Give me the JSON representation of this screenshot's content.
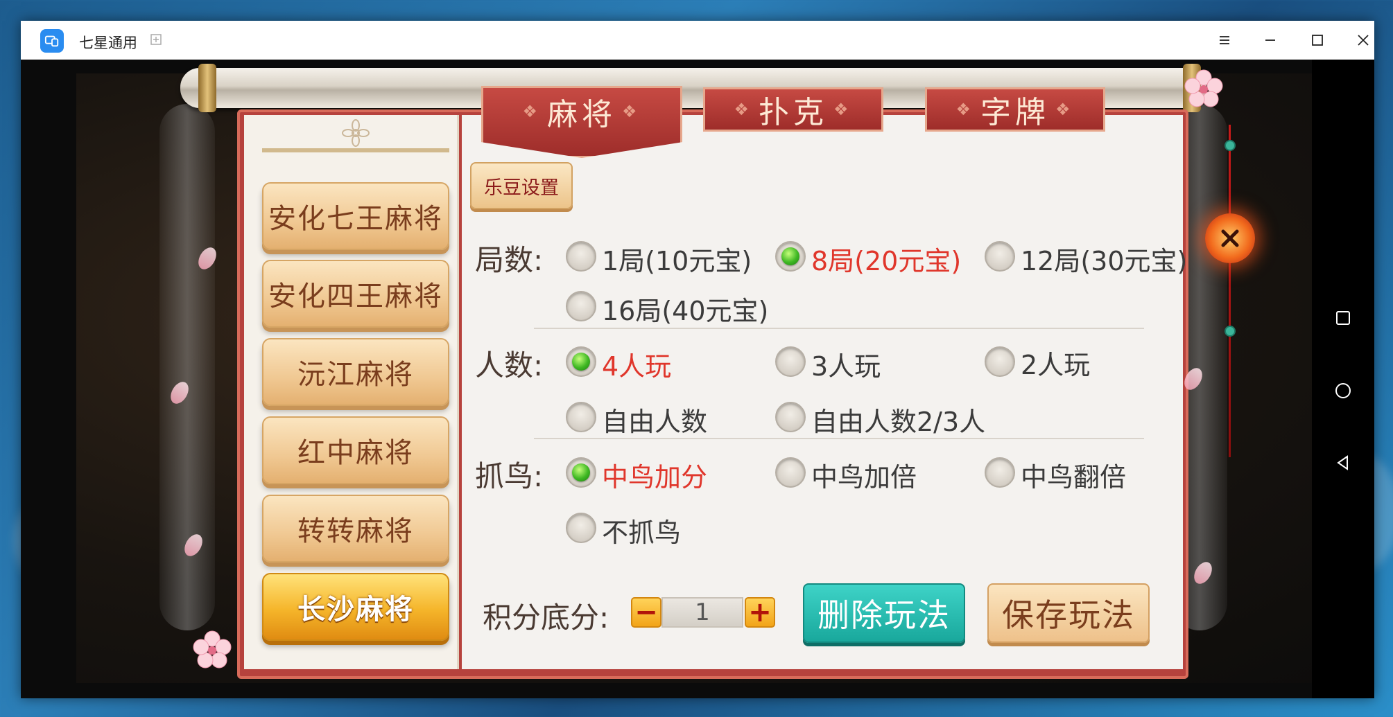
{
  "window": {
    "title": "七星通用"
  },
  "dialog": {
    "tabs": [
      {
        "label": "麻将",
        "active": true
      },
      {
        "label": "扑克",
        "active": false
      },
      {
        "label": "字牌",
        "active": false
      }
    ],
    "ledou_settings_label": "乐豆设置",
    "game_list": [
      {
        "label": "安化七王麻将",
        "active": false
      },
      {
        "label": "安化四王麻将",
        "active": false
      },
      {
        "label": "沅江麻将",
        "active": false
      },
      {
        "label": "红中麻将",
        "active": false
      },
      {
        "label": "转转麻将",
        "active": false
      },
      {
        "label": "长沙麻将",
        "active": true
      }
    ],
    "rounds": {
      "label": "局数:",
      "options": [
        {
          "label": "1局(10元宝)",
          "selected": false
        },
        {
          "label": "8局(20元宝)",
          "selected": true
        },
        {
          "label": "12局(30元宝)",
          "selected": false
        },
        {
          "label": "16局(40元宝)",
          "selected": false
        }
      ]
    },
    "players": {
      "label": "人数:",
      "options": [
        {
          "label": "4人玩",
          "selected": true
        },
        {
          "label": "3人玩",
          "selected": false
        },
        {
          "label": "2人玩",
          "selected": false
        },
        {
          "label": "自由人数",
          "selected": false
        },
        {
          "label": "自由人数2/3人",
          "selected": false
        }
      ]
    },
    "birds": {
      "label": "抓鸟:",
      "options": [
        {
          "label": "中鸟加分",
          "selected": true
        },
        {
          "label": "中鸟加倍",
          "selected": false
        },
        {
          "label": "中鸟翻倍",
          "selected": false
        },
        {
          "label": "不抓鸟",
          "selected": false
        }
      ]
    },
    "base_score": {
      "label": "积分底分:",
      "value": "1",
      "minus": "−",
      "plus": "+"
    },
    "delete_label": "删除玩法",
    "save_label": "保存玩法"
  },
  "colors": {
    "selected_text": "#e0362b",
    "panel_red": "#b6423d",
    "delete_teal": "#19a89c",
    "active_gold": "#f5b52a"
  }
}
